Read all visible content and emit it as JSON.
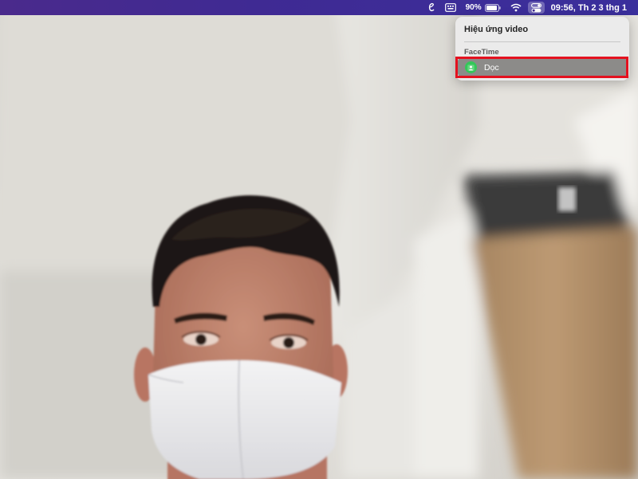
{
  "menubar": {
    "battery_percent": "90%",
    "clock": "09:56, Th 2 3 thg 1",
    "icons": [
      "script-e-icon",
      "keyboard-input-icon",
      "battery-icon",
      "wifi-icon",
      "control-center-icon"
    ]
  },
  "panel": {
    "title": "Hiệu ứng video",
    "section": "FaceTime",
    "items": [
      {
        "label": "Dọc",
        "icon": "portrait-person-icon",
        "selected": true
      }
    ]
  },
  "colors": {
    "menubar": "#3f2a93",
    "accent_green": "#34c759",
    "highlight_red": "#e4111f",
    "selected_row": "#8c8b89"
  }
}
